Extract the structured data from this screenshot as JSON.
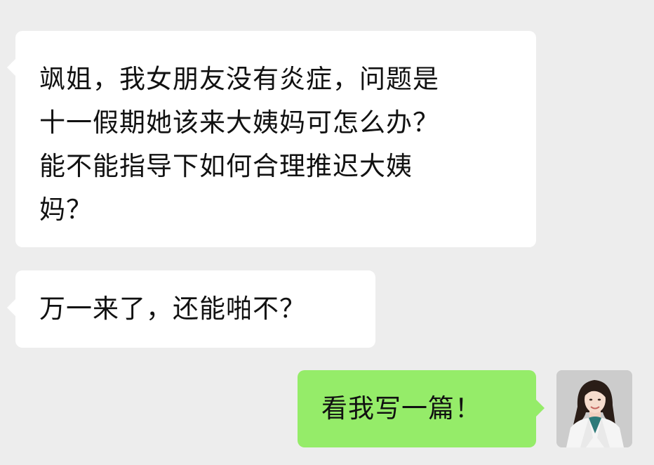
{
  "messages": [
    {
      "direction": "incoming",
      "text": "飒姐，我女朋友没有炎症，问题是\n十一假期她该来大姨妈可怎么办？\n能不能指导下如何合理推迟大姨\n妈？"
    },
    {
      "direction": "incoming",
      "text": "万一来了，还能啪不？"
    },
    {
      "direction": "outgoing",
      "text": "看我写一篇！"
    }
  ],
  "colors": {
    "background": "#ededed",
    "incoming_bubble": "#ffffff",
    "outgoing_bubble": "#95ec69",
    "text": "#111111"
  },
  "icons": {
    "sender_avatar": "doctor-avatar-icon"
  }
}
